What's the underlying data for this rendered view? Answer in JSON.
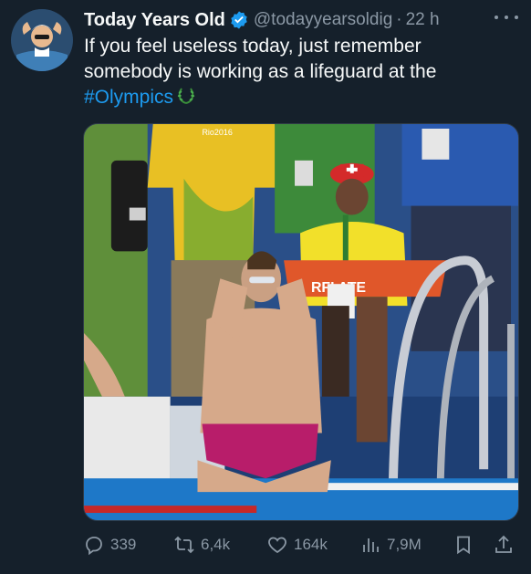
{
  "author": {
    "display_name": "Today Years Old",
    "handle": "@todayyearsoldig",
    "separator": "·",
    "time": "22 h",
    "avatar_icon": "person-avatar-icon",
    "verified_color": "#1d9bf0"
  },
  "tweet": {
    "line1": "If you feel useless today, just remember",
    "line2": "somebody is working as a lifeguard at the",
    "hashtag": "#Olympics",
    "hashtag_emoji_icon": "olympic-wreath-icon"
  },
  "media": {
    "description_icon": "photo-olympic-pool-swimmer-lifeguard",
    "venue_sign": "Rio2016",
    "chair_label": "RFI ATE"
  },
  "actions": {
    "replies": "339",
    "retweets": "6,4k",
    "likes": "164k",
    "views": "7,9M"
  },
  "colors": {
    "background": "#15202b",
    "text": "#f7f9f9",
    "muted": "#8b98a5",
    "accent": "#1d9bf0"
  }
}
